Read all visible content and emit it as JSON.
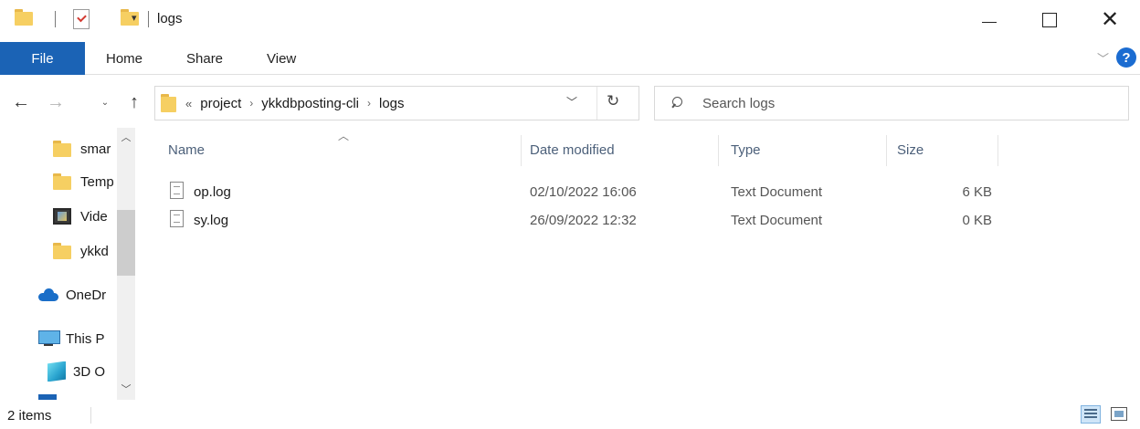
{
  "window": {
    "title": "logs",
    "controls": {
      "minimize": "minimize",
      "maximize": "maximize",
      "close": "close"
    }
  },
  "quick_access": {
    "dropdown_glyph": "▾"
  },
  "ribbon": {
    "tabs": [
      "File",
      "Home",
      "Share",
      "View"
    ],
    "help_label": "?",
    "active_color": "#1b63b5"
  },
  "nav": {
    "back_glyph": "←",
    "forward_glyph": "→",
    "recent_glyph": "⌄",
    "up_glyph": "↑",
    "address": {
      "overflow": "«",
      "crumbs": [
        "project",
        "ykkdbposting-cli",
        "logs"
      ],
      "separator": "›"
    },
    "refresh_glyph": "↻",
    "search_placeholder": "Search logs"
  },
  "navigation_pane": {
    "items": [
      {
        "label": "smar",
        "icon": "folder-icon"
      },
      {
        "label": "Temp",
        "icon": "folder-icon"
      },
      {
        "label": "Vide",
        "icon": "video-folder-icon"
      },
      {
        "label": "ykkd",
        "icon": "folder-icon"
      },
      {
        "label": "OneDr",
        "icon": "onedrive-cloud-icon"
      },
      {
        "label": "This P",
        "icon": "this-pc-icon"
      },
      {
        "label": "3D O",
        "icon": "3d-objects-icon"
      }
    ]
  },
  "file_list": {
    "columns": [
      "Name",
      "Date modified",
      "Type",
      "Size"
    ],
    "sort_glyph": "^",
    "rows": [
      {
        "name": "op.log",
        "date": "02/10/2022 16:06",
        "type": "Text Document",
        "size": "6 KB"
      },
      {
        "name": "sy.log",
        "date": "26/09/2022 12:32",
        "type": "Text Document",
        "size": "0 KB"
      }
    ]
  },
  "status_bar": {
    "item_count": "2 items"
  }
}
